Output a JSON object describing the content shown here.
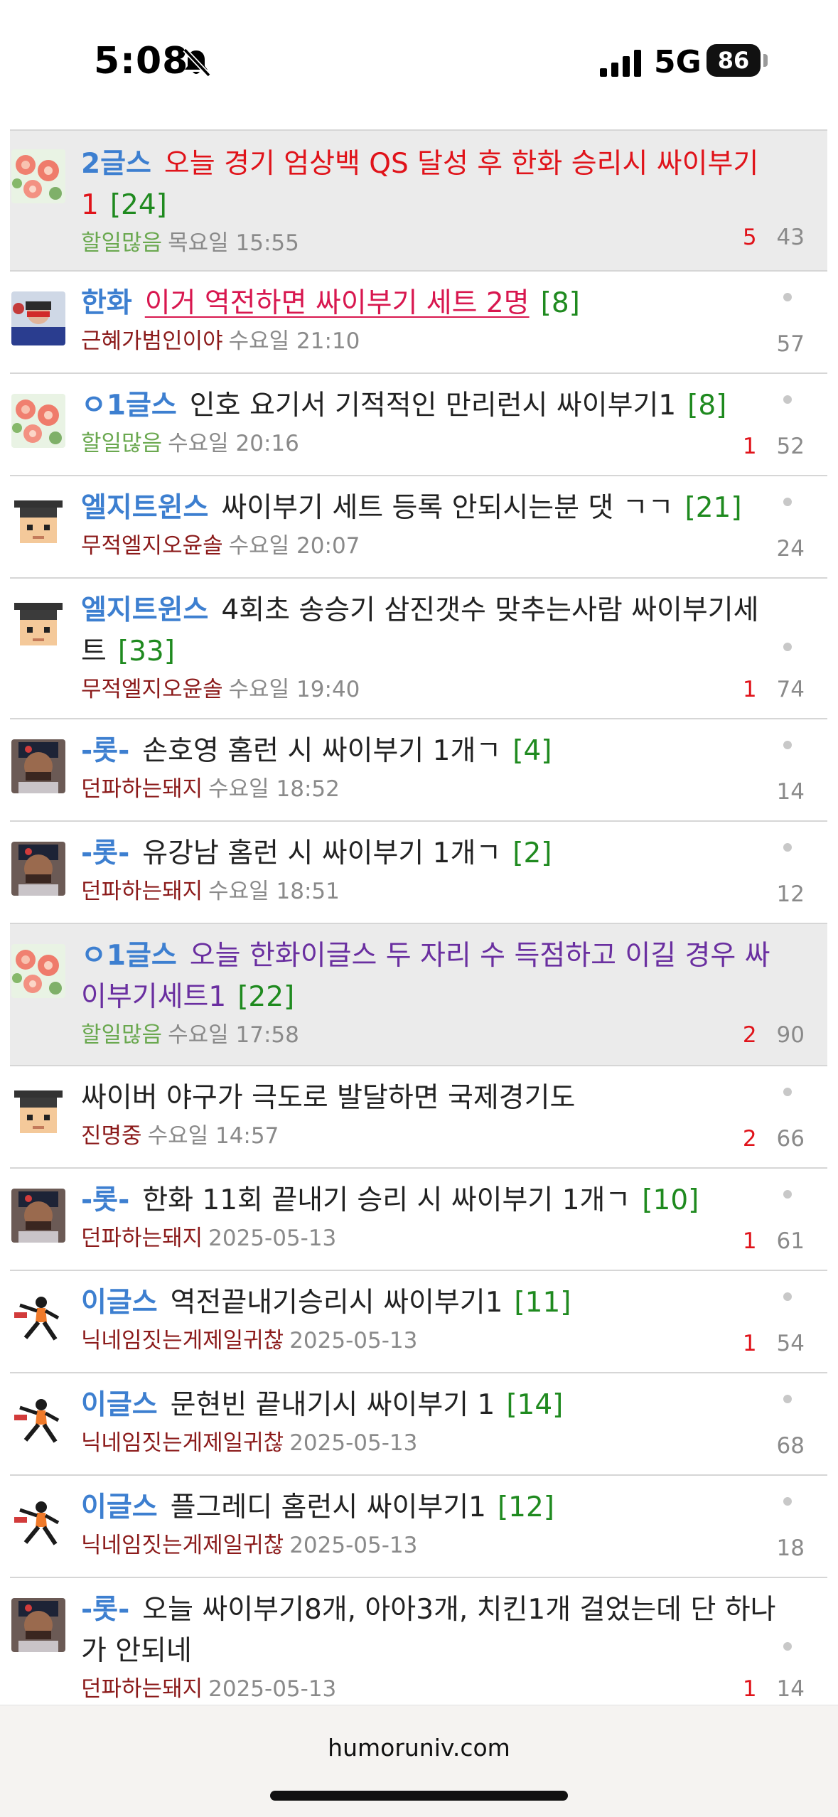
{
  "status_bar": {
    "time": "5:08",
    "network": "5G",
    "battery": "86"
  },
  "posts": [
    {
      "category": "2글스",
      "title": "오늘 경기 엄상백 QS 달성 후 한화 승리시 싸이부기 1",
      "comments": "[24]",
      "author": "할일많음",
      "date": "목요일 15:55",
      "recommend": "5",
      "views": "43"
    },
    {
      "category": "한화",
      "title": "이거 역전하면 싸이부기 세트 2명",
      "comments": "[8]",
      "author": "근혜가범인이야",
      "date": "수요일 21:10",
      "recommend": "",
      "views": "57"
    },
    {
      "category": "ㅇ1글스",
      "title": "인호 요기서 기적적인 만리런시 싸이부기1",
      "comments": "[8]",
      "author": "할일많음",
      "date": "수요일 20:16",
      "recommend": "1",
      "views": "52"
    },
    {
      "category": "엘지트윈스",
      "title": "싸이부기 세트 등록 안되시는분 댓 ㄱㄱ",
      "comments": "[21]",
      "author": "무적엘지오윤솔",
      "date": "수요일 20:07",
      "recommend": "",
      "views": "24"
    },
    {
      "category": "엘지트윈스",
      "title": "4회초 송승기 삼진갯수 맞추는사람 싸이부기세트",
      "comments": "[33]",
      "author": "무적엘지오윤솔",
      "date": "수요일 19:40",
      "recommend": "1",
      "views": "74"
    },
    {
      "category": "-롯-",
      "title": "손호영 홈런 시 싸이부기 1개ㄱ",
      "comments": "[4]",
      "author": "던파하는돼지",
      "date": "수요일 18:52",
      "recommend": "",
      "views": "14"
    },
    {
      "category": "-롯-",
      "title": "유강남 홈런 시 싸이부기 1개ㄱ",
      "comments": "[2]",
      "author": "던파하는돼지",
      "date": "수요일 18:51",
      "recommend": "",
      "views": "12"
    },
    {
      "category": "ㅇ1글스",
      "title": "오늘 한화이글스 두 자리 수 득점하고 이길 경우 싸이부기세트1",
      "comments": "[22]",
      "author": "할일많음",
      "date": "수요일 17:58",
      "recommend": "2",
      "views": "90"
    },
    {
      "category": "",
      "title": "싸이버 야구가 극도로 발달하면 국제경기도",
      "comments": "",
      "author": "진명중",
      "date": "수요일 14:57",
      "recommend": "2",
      "views": "66"
    },
    {
      "category": "-롯-",
      "title": "한화 11회 끝내기 승리 시 싸이부기 1개ㄱ",
      "comments": "[10]",
      "author": "던파하는돼지",
      "date": "2025-05-13",
      "recommend": "1",
      "views": "61"
    },
    {
      "category": "이글스",
      "title": "역전끝내기승리시 싸이부기1",
      "comments": "[11]",
      "author": "닉네임짓는게제일귀찮",
      "date": "2025-05-13",
      "recommend": "1",
      "views": "54"
    },
    {
      "category": "이글스",
      "title": "문현빈 끝내기시 싸이부기 1",
      "comments": "[14]",
      "author": "닉네임짓는게제일귀찮",
      "date": "2025-05-13",
      "recommend": "",
      "views": "68"
    },
    {
      "category": "이글스",
      "title": "플그레디 홈런시 싸이부기1",
      "comments": "[12]",
      "author": "닉네임짓는게제일귀찮",
      "date": "2025-05-13",
      "recommend": "",
      "views": "18"
    },
    {
      "category": "-롯-",
      "title": "오늘 싸이부기8개, 아아3개, 치킨1개 걸었는데 단 하나가 안되네",
      "comments": "",
      "author": "던파하는돼지",
      "date": "2025-05-13",
      "recommend": "1",
      "views": "14"
    }
  ],
  "footer": {
    "domain": "humoruniv.com"
  },
  "colors": {
    "category": "#3d7fd0",
    "comment_count": "#1f8a1f",
    "recommend": "#e0131a",
    "author": "#8b1a1a",
    "author_highlight": "#6aa84f",
    "highlight_row": "#ebebeb"
  }
}
